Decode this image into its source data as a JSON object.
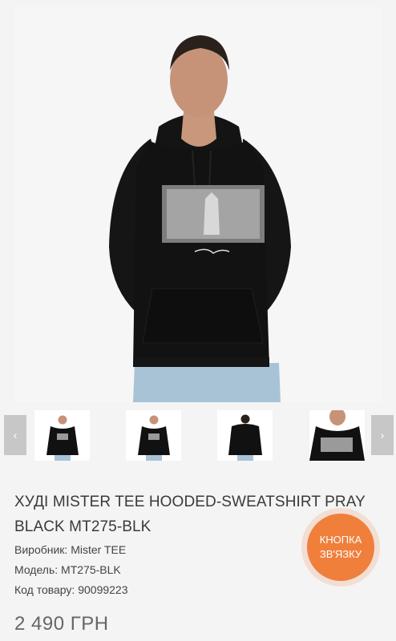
{
  "product": {
    "title": "ХУДІ MISTER TEE HOODED-SWEATSHIRT PRAY BLACK MT275-BLK",
    "manufacturer_label": "Виробник:",
    "manufacturer": "Mister TEE",
    "model_label": "Модель:",
    "model": "MT275-BLK",
    "code_label": "Код товару:",
    "code": "90099223",
    "price": "2 490 ГРН"
  },
  "gallery": {
    "prev_icon": "chevron-left-icon",
    "next_icon": "chevron-right-icon",
    "prev_glyph": "‹",
    "next_glyph": "›",
    "thumbnail_count": 4
  },
  "contact_button": {
    "line1": "КНОПКА",
    "line2": "ЗВ'ЯЗКУ",
    "color": "#f07f3c"
  },
  "colors": {
    "background": "#f4f4f4",
    "hoodie": "#121212",
    "jeans": "#a9c3d6",
    "accent": "#f07f3c"
  }
}
